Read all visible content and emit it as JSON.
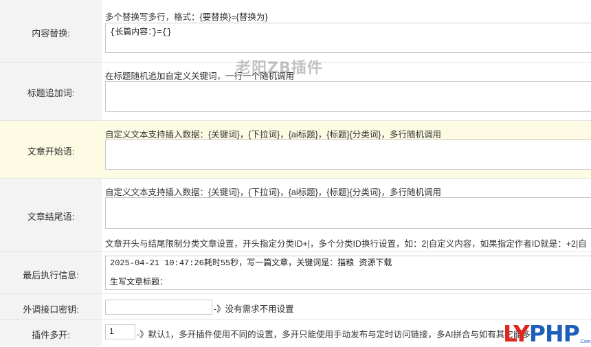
{
  "rows": {
    "content_replace": {
      "label": "内容替换:",
      "desc": "多个替换写多行，格式：{要替换}={替换为}",
      "value": "{长篇内容：}={}"
    },
    "title_append": {
      "label": "标题追加词:",
      "desc": "在标题随机追加自定义关键词，一行一个随机调用",
      "value": ""
    },
    "article_start": {
      "label": "文章开始语:",
      "desc": "自定义文本支持插入数据：{关键词}，{下拉词}，{ai标题}，{标题}{分类词}，多行随机调用",
      "value": ""
    },
    "article_end": {
      "label": "文章结尾语:",
      "desc": "自定义文本支持插入数据：{关键词}，{下拉词}，{ai标题}，{标题}{分类词}，多行随机调用",
      "value": "",
      "note": "文章开头与结尾限制分类文章设置，开头指定分类ID+|，多个分类ID换行设置，如：2|自定义内容，如果指定作者ID就是：+2|自"
    },
    "last_exec": {
      "label": "最后执行信息:",
      "value": "2025-04-21 10:47:26耗时55秒，写一篇文章，关键词是：猫粮 资源下载\n\n生写文章标题："
    },
    "api_key": {
      "label": "外调接口密钥:",
      "value": "",
      "hint": "-》没有需求不用设置"
    },
    "multi_open": {
      "label": "插件多开:",
      "value": "1",
      "hint": "-》默认1，多开插件使用不同的设置，多开只能使用手动发布与定时访问链接，多AI拼合与如有其它能多"
    }
  },
  "watermark": "老阳ZB插件",
  "logo": {
    "red": "LY",
    "blue": "PHP",
    "sub": ".Com"
  },
  "colors": {
    "highlight_row": "#fdfbe3",
    "label_bg": "#f3f3f3",
    "logo_red": "#e0261f",
    "logo_blue": "#1d5fb8"
  }
}
